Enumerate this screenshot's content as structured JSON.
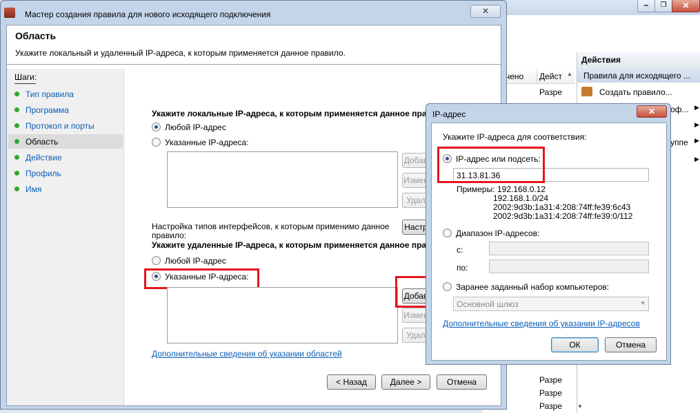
{
  "background_window": {
    "columns": [
      "чено",
      "Дейст"
    ],
    "cells": [
      "Разре",
      "Разре",
      "Разре",
      "Разре",
      "Разре",
      "Разре"
    ],
    "right_partial": [
      "оф...",
      "уппе"
    ],
    "actions_title": "Действия",
    "actions_section": "Правила для исходящего ...",
    "create_rule": "Создать правило..."
  },
  "wizard": {
    "title": "Мастер создания правила для нового исходящего подключения",
    "heading": "Область",
    "subheading": "Укажите локальный и удаленный IP-адреса, к которым применяется данное правило.",
    "steps_title": "Шаги:",
    "steps": [
      "Тип правила",
      "Программа",
      "Протокол и порты",
      "Область",
      "Действие",
      "Профиль",
      "Имя"
    ],
    "local_title": "Укажите локальные IP-адреса, к которым применяется данное пра",
    "any_ip": "Любой IP-адрес",
    "specified_ips": "Указанные IP-адреса:",
    "add_btn": "Добав",
    "edit_btn": "Измен",
    "remove_btn": "Удал",
    "iface_text_1": "Настройка типов интерфейсов, к которым применимо данное",
    "iface_text_2": "правило:",
    "iface_btn": "Настр",
    "remote_title": "Укажите удаленные IP-адреса, к которым применяется данное пра",
    "remote_any_ip": "Любой IP-адрес",
    "remote_specified_ips": "Указанные IP-адреса:",
    "remote_add_btn": "Добав",
    "remote_edit_btn": "Измен",
    "remote_remove_btn": "Удал",
    "more_link": "Дополнительные сведения об указании областей",
    "back_btn": "< Назад",
    "next_btn": "Далее >",
    "cancel_btn": "Отмена"
  },
  "ip_dialog": {
    "title": "IP-адрес",
    "instruction": "Укажите IP-адреса для соответствия:",
    "option_ip": "IP-адрес или подсеть:",
    "ip_value": "31.13.81.36",
    "examples_label": "Примеры:",
    "examples": [
      "192.168.0.12",
      "192.168.1.0/24",
      "2002:9d3b:1a31:4:208:74ff:fe39:6c43",
      "2002:9d3b:1a31:4:208:74ff:fe39:0/112"
    ],
    "option_range": "Диапазон IP-адресов:",
    "from_label": "с:",
    "to_label": "по:",
    "option_preset": "Заранее заданный набор компьютеров:",
    "preset_value": "Основной шлюз",
    "more_link": "Дополнительные сведения об указании IP-адресов",
    "ok_btn": "ОК",
    "cancel_btn": "Отмена"
  }
}
